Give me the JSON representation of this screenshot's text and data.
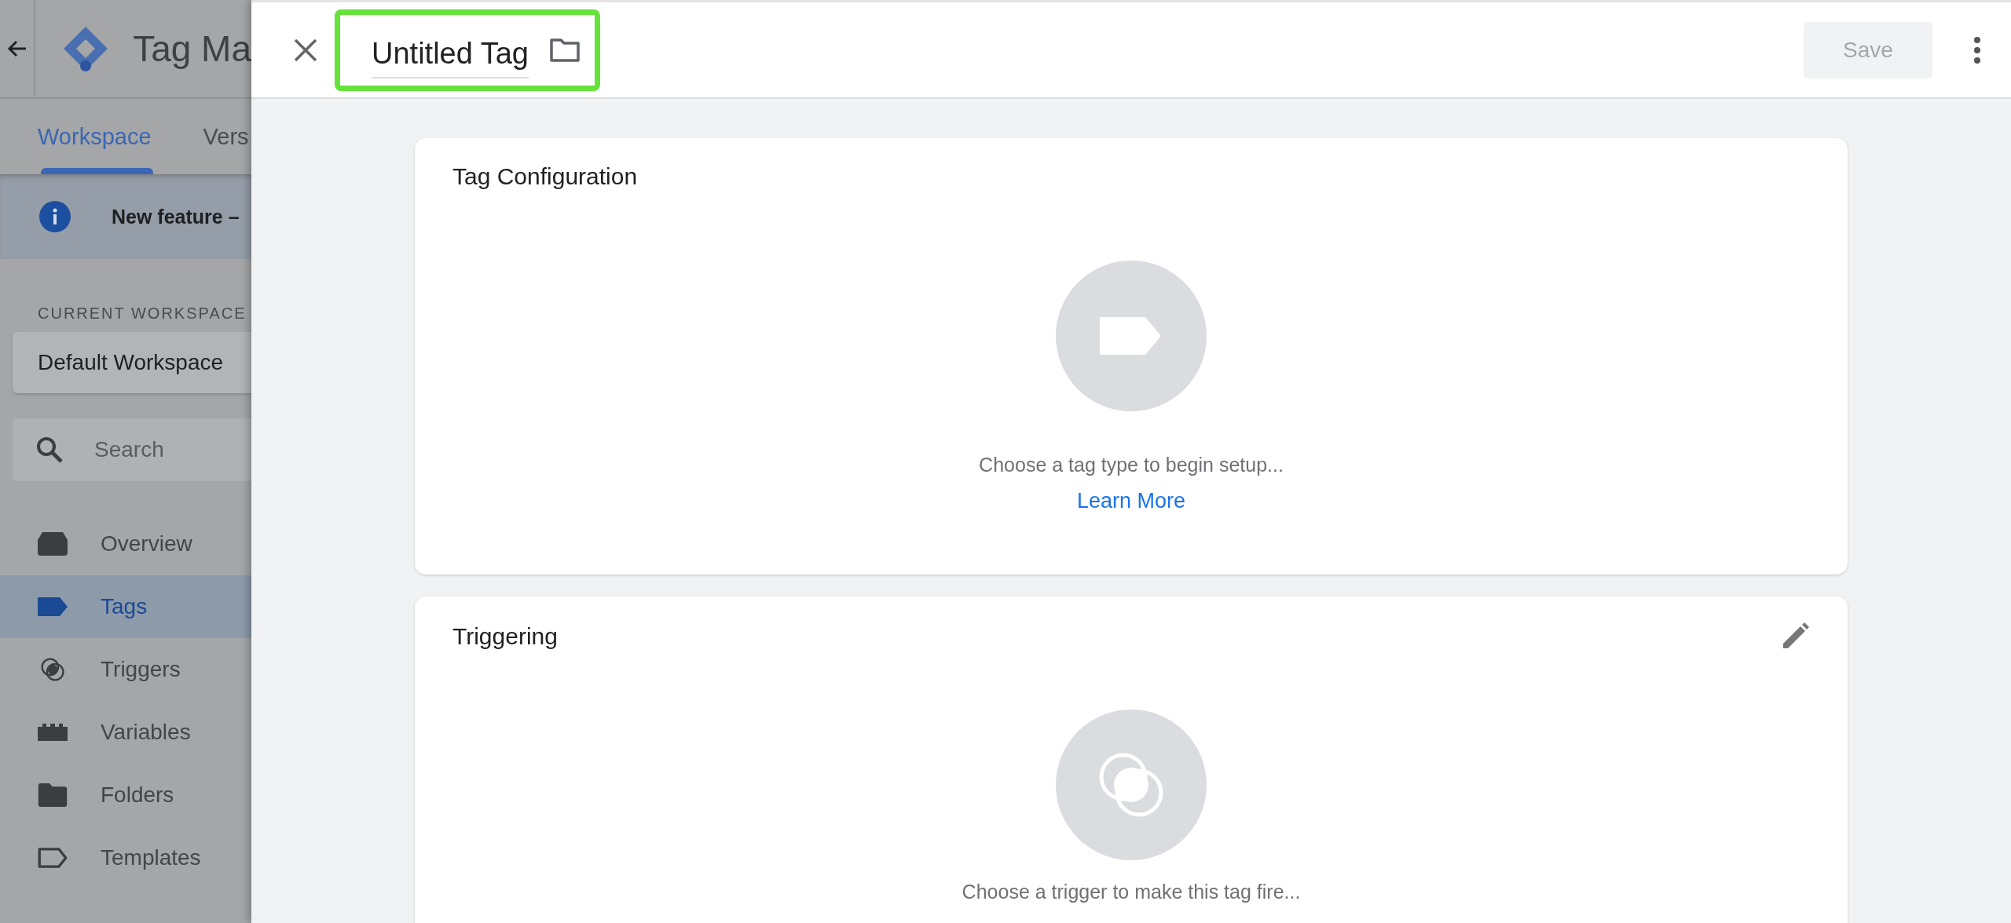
{
  "sidebar": {
    "app_title": "Tag Ma",
    "tabs": [
      {
        "label": "Workspace",
        "selected": true
      },
      {
        "label": "Vers",
        "selected": false
      }
    ],
    "notice": {
      "text": "New feature –"
    },
    "workspace_label": "CURRENT WORKSPACE",
    "workspace_name": "Default Workspace",
    "search": {
      "placeholder": "Search"
    },
    "nav": [
      {
        "label": "Overview",
        "kind": "overview",
        "selected": false
      },
      {
        "label": "Tags",
        "kind": "tag",
        "selected": true
      },
      {
        "label": "Triggers",
        "kind": "trigger",
        "selected": false
      },
      {
        "label": "Variables",
        "kind": "variable",
        "selected": false
      },
      {
        "label": "Folders",
        "kind": "folder",
        "selected": false
      },
      {
        "label": "Templates",
        "kind": "template",
        "selected": false
      }
    ]
  },
  "editor": {
    "title": "Untitled Tag",
    "save": {
      "label": "Save",
      "disabled": true
    },
    "cards": [
      {
        "kind": "tag",
        "title": "Tag Configuration",
        "hint": "Choose a tag type to begin setup...",
        "link": "Learn More",
        "editable": false
      },
      {
        "kind": "trigger",
        "title": "Triggering",
        "hint": "Choose a trigger to make this tag fire...",
        "editable": true
      }
    ]
  }
}
